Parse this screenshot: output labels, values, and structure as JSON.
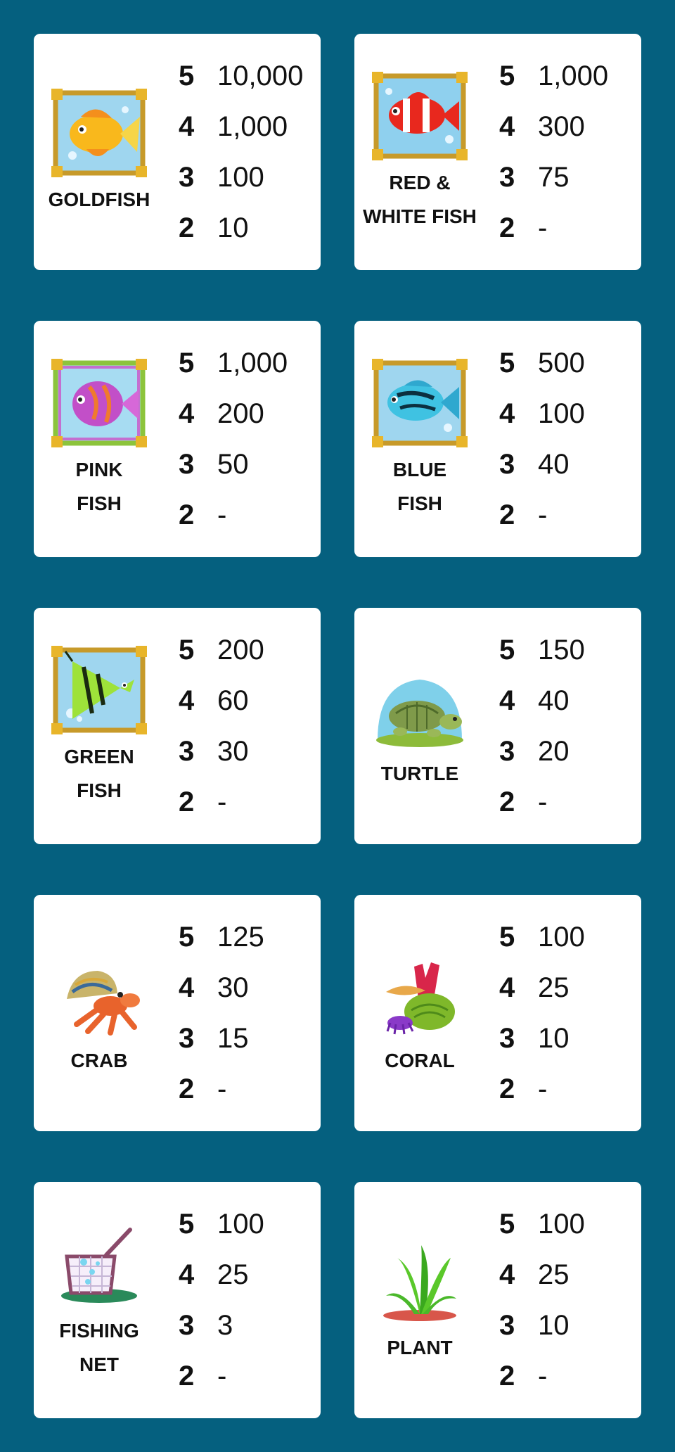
{
  "colors": {
    "background": "#05607f",
    "card": "#ffffff",
    "text": "#111111"
  },
  "symbols": [
    {
      "name": "GOLDFISH",
      "icon": "goldfish-icon",
      "pays": [
        {
          "count": "5",
          "value": "10,000"
        },
        {
          "count": "4",
          "value": "1,000"
        },
        {
          "count": "3",
          "value": "100"
        },
        {
          "count": "2",
          "value": "10"
        }
      ]
    },
    {
      "name": "RED &\nWHITE FISH",
      "icon": "red-white-fish-icon",
      "pays": [
        {
          "count": "5",
          "value": "1,000"
        },
        {
          "count": "4",
          "value": "300"
        },
        {
          "count": "3",
          "value": "75"
        },
        {
          "count": "2",
          "value": "-"
        }
      ]
    },
    {
      "name": "PINK\nFISH",
      "icon": "pink-fish-icon",
      "pays": [
        {
          "count": "5",
          "value": "1,000"
        },
        {
          "count": "4",
          "value": "200"
        },
        {
          "count": "3",
          "value": "50"
        },
        {
          "count": "2",
          "value": "-"
        }
      ]
    },
    {
      "name": "BLUE\nFISH",
      "icon": "blue-fish-icon",
      "pays": [
        {
          "count": "5",
          "value": "500"
        },
        {
          "count": "4",
          "value": "100"
        },
        {
          "count": "3",
          "value": "40"
        },
        {
          "count": "2",
          "value": "-"
        }
      ]
    },
    {
      "name": "GREEN\nFISH",
      "icon": "green-fish-icon",
      "pays": [
        {
          "count": "5",
          "value": "200"
        },
        {
          "count": "4",
          "value": "60"
        },
        {
          "count": "3",
          "value": "30"
        },
        {
          "count": "2",
          "value": "-"
        }
      ]
    },
    {
      "name": "TURTLE",
      "icon": "turtle-icon",
      "pays": [
        {
          "count": "5",
          "value": "150"
        },
        {
          "count": "4",
          "value": "40"
        },
        {
          "count": "3",
          "value": "20"
        },
        {
          "count": "2",
          "value": "-"
        }
      ]
    },
    {
      "name": "CRAB",
      "icon": "crab-icon",
      "pays": [
        {
          "count": "5",
          "value": "125"
        },
        {
          "count": "4",
          "value": "30"
        },
        {
          "count": "3",
          "value": "15"
        },
        {
          "count": "2",
          "value": "-"
        }
      ]
    },
    {
      "name": "CORAL",
      "icon": "coral-icon",
      "pays": [
        {
          "count": "5",
          "value": "100"
        },
        {
          "count": "4",
          "value": "25"
        },
        {
          "count": "3",
          "value": "10"
        },
        {
          "count": "2",
          "value": "-"
        }
      ]
    },
    {
      "name": "FISHING\nNET",
      "icon": "fishing-net-icon",
      "pays": [
        {
          "count": "5",
          "value": "100"
        },
        {
          "count": "4",
          "value": "25"
        },
        {
          "count": "3",
          "value": "3"
        },
        {
          "count": "2",
          "value": "-"
        }
      ]
    },
    {
      "name": "PLANT",
      "icon": "plant-icon",
      "pays": [
        {
          "count": "5",
          "value": "100"
        },
        {
          "count": "4",
          "value": "25"
        },
        {
          "count": "3",
          "value": "10"
        },
        {
          "count": "2",
          "value": "-"
        }
      ]
    }
  ]
}
